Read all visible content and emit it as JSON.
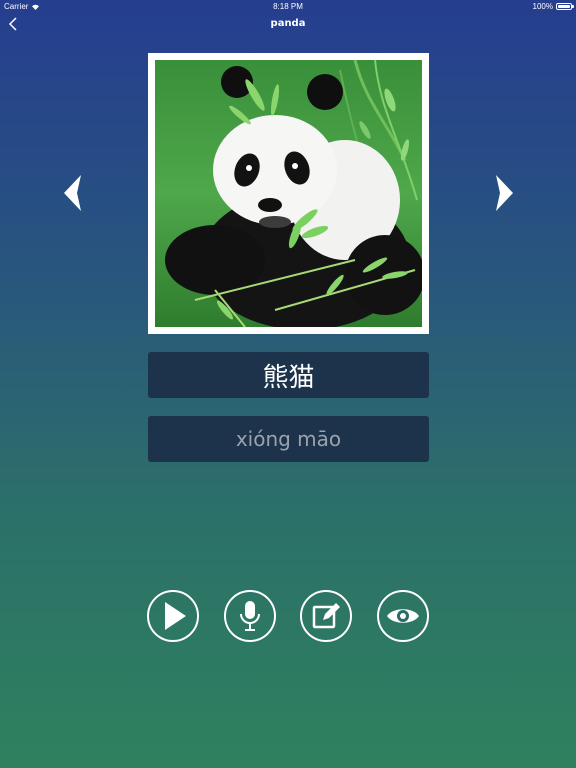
{
  "status_bar": {
    "carrier": "Carrier",
    "time": "8:18 PM",
    "battery": "100%"
  },
  "nav": {
    "title": "panda",
    "back_icon": "chevron-left-icon"
  },
  "card": {
    "image_subject": "giant panda eating bamboo",
    "hanzi": "熊猫",
    "pinyin": "xióng māo"
  },
  "navigation_arrows": {
    "previous_icon": "triangle-left-icon",
    "next_icon": "triangle-right-icon"
  },
  "controls": [
    {
      "name": "play",
      "icon": "play-icon"
    },
    {
      "name": "record",
      "icon": "microphone-icon"
    },
    {
      "name": "write",
      "icon": "edit-icon"
    },
    {
      "name": "view",
      "icon": "eye-icon"
    }
  ],
  "colors": {
    "background_top": "#253e8f",
    "background_bottom": "#2e815e",
    "word_box": "#1d334b",
    "pinyin_text": "#9aa3ad"
  }
}
